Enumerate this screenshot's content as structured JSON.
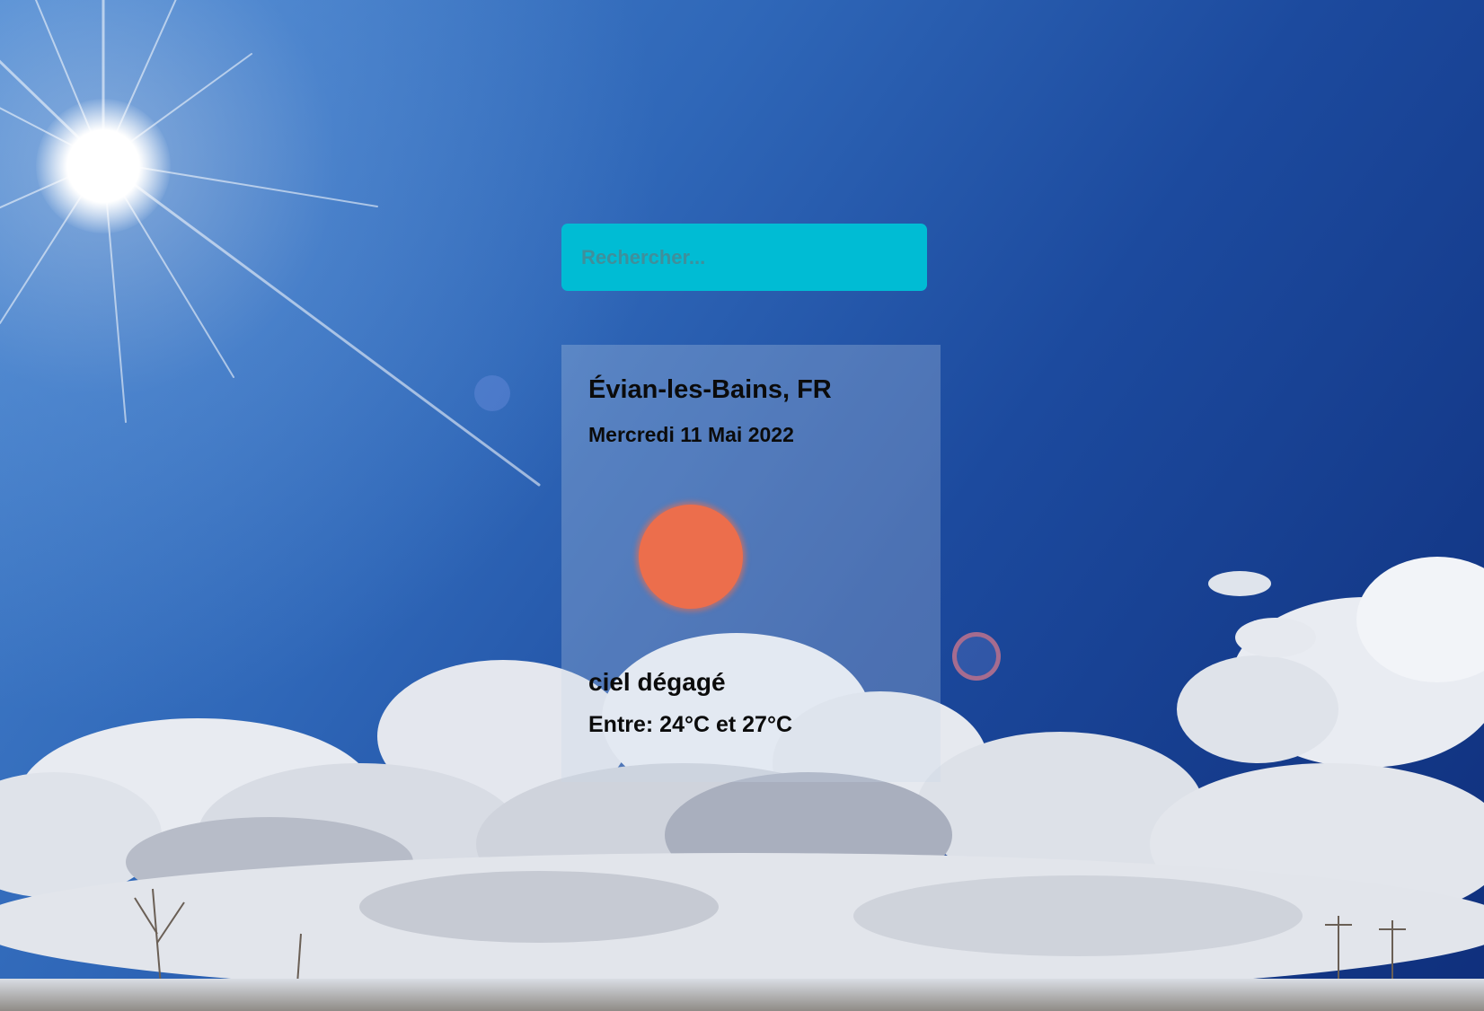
{
  "search": {
    "placeholder": "Rechercher...",
    "value": ""
  },
  "weather": {
    "location": "Évian-les-Bains, FR",
    "date": "Mercredi 11 Mai 2022",
    "icon": "sun-icon",
    "description": "ciel dégagé",
    "temp_range": "Entre: 24°C et 27°C"
  },
  "background": {
    "scene": "sunny-sky-icon"
  },
  "colors": {
    "search_bg": "#00bcd4",
    "sun_icon": "#ec6e4c",
    "text": "#0b0b0b"
  }
}
